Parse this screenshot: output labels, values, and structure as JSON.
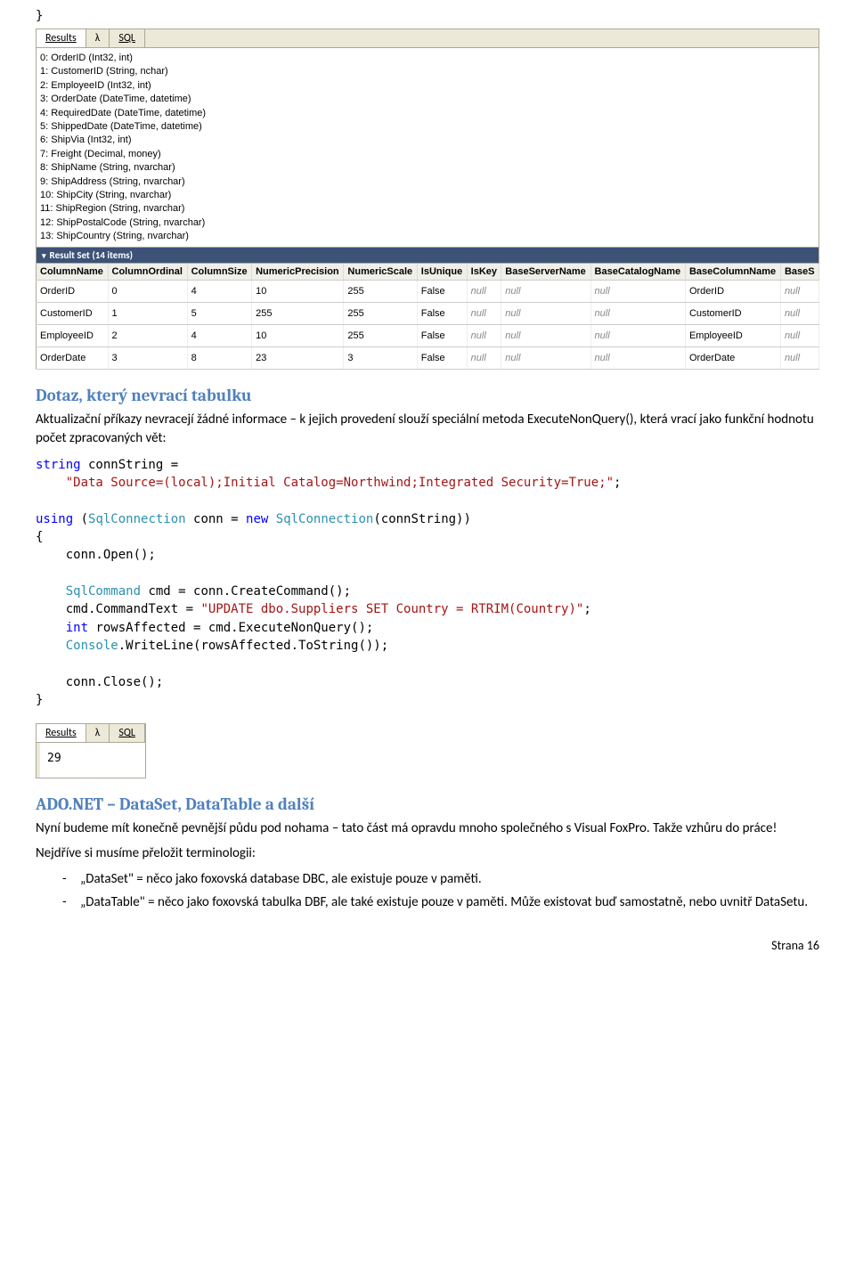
{
  "brace_close": "}",
  "tabs1": {
    "results": "Results",
    "lambda": "λ",
    "sql": "SQL"
  },
  "schema_lines": [
    "0: OrderID (Int32, int)",
    "1: CustomerID (String, nchar)",
    "2: EmployeeID (Int32, int)",
    "3: OrderDate (DateTime, datetime)",
    "4: RequiredDate (DateTime, datetime)",
    "5: ShippedDate (DateTime, datetime)",
    "6: ShipVia (Int32, int)",
    "7: Freight (Decimal, money)",
    "8: ShipName (String, nvarchar)",
    "9: ShipAddress (String, nvarchar)",
    "10: ShipCity (String, nvarchar)",
    "11: ShipRegion (String, nvarchar)",
    "12: ShipPostalCode (String, nvarchar)",
    "13: ShipCountry (String, nvarchar)"
  ],
  "resultset_header": "Result Set (14 items)",
  "columns": [
    "ColumnName",
    "ColumnOrdinal",
    "ColumnSize",
    "NumericPrecision",
    "NumericScale",
    "IsUnique",
    "IsKey",
    "BaseServerName",
    "BaseCatalogName",
    "BaseColumnName",
    "BaseS"
  ],
  "rows": [
    {
      "ColumnName": "OrderID",
      "ColumnOrdinal": "0",
      "ColumnSize": "4",
      "NumericPrecision": "10",
      "NumericScale": "255",
      "IsUnique": "False",
      "IsKey": "null",
      "BaseServerName": "null",
      "BaseCatalogName": "null",
      "BaseColumnName": "OrderID",
      "BaseS": "null"
    },
    {
      "ColumnName": "CustomerID",
      "ColumnOrdinal": "1",
      "ColumnSize": "5",
      "NumericPrecision": "255",
      "NumericScale": "255",
      "IsUnique": "False",
      "IsKey": "null",
      "BaseServerName": "null",
      "BaseCatalogName": "null",
      "BaseColumnName": "CustomerID",
      "BaseS": "null"
    },
    {
      "ColumnName": "EmployeeID",
      "ColumnOrdinal": "2",
      "ColumnSize": "4",
      "NumericPrecision": "10",
      "NumericScale": "255",
      "IsUnique": "False",
      "IsKey": "null",
      "BaseServerName": "null",
      "BaseCatalogName": "null",
      "BaseColumnName": "EmployeeID",
      "BaseS": "null"
    },
    {
      "ColumnName": "OrderDate",
      "ColumnOrdinal": "3",
      "ColumnSize": "8",
      "NumericPrecision": "23",
      "NumericScale": "3",
      "IsUnique": "False",
      "IsKey": "null",
      "BaseServerName": "null",
      "BaseCatalogName": "null",
      "BaseColumnName": "OrderDate",
      "BaseS": "null"
    }
  ],
  "section1_title": "Dotaz, který nevrací tabulku",
  "section1_body": "Aktualizační příkazy nevracejí žádné informace – k jejich provedení slouží speciální metoda ExecuteNonQuery(), která vrací jako funkční hodnotu počet zpracovaných vět:",
  "code2": {
    "l1a": "string",
    "l1b": " connString =",
    "l2a": "    ",
    "l2b": "\"Data Source=(local);Initial Catalog=Northwind;Integrated Security=True;\"",
    "l2c": ";",
    "l3": "",
    "l4a": "using",
    "l4b": " (",
    "l4c": "SqlConnection",
    "l4d": " conn = ",
    "l4e": "new",
    "l4f": " ",
    "l4g": "SqlConnection",
    "l4h": "(connString))",
    "l5": "{",
    "l6": "    conn.Open();",
    "l7": "",
    "l8a": "    ",
    "l8b": "SqlCommand",
    "l8c": " cmd = conn.CreateCommand();",
    "l9a": "    cmd.CommandText = ",
    "l9b": "\"UPDATE dbo.Suppliers SET Country = RTRIM(Country)\"",
    "l9c": ";",
    "l10a": "    ",
    "l10b": "int",
    "l10c": " rowsAffected = cmd.ExecuteNonQuery();",
    "l11a": "    ",
    "l11b": "Console",
    "l11c": ".WriteLine(rowsAffected.ToString());",
    "l12": "",
    "l13": "    conn.Close();",
    "l14": "}"
  },
  "result_small_value": "29",
  "tabs2": {
    "results": "Results",
    "lambda": "λ",
    "sql": "SQL"
  },
  "section2_title": "ADO.NET – DataSet, DataTable a další",
  "section2_body": "Nyní budeme mít konečně pevnější půdu pod nohama – tato část má opravdu mnoho společného s Visual FoxPro. Takže vzhůru do práce!",
  "section2_body2": "Nejdříve si musíme přeložit terminologii:",
  "bullets": [
    "„DataSet\" = něco jako foxovská database DBC, ale existuje pouze v paměti.",
    "„DataTable\" = něco jako foxovská tabulka DBF, ale také existuje pouze v paměti. Může existovat buď samostatně, nebo uvnitř DataSetu."
  ],
  "page_number": "Strana 16"
}
